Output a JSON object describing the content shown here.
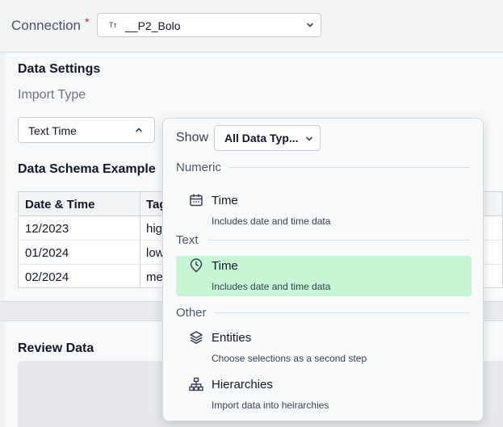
{
  "connection": {
    "label": "Connection",
    "required_marker": "*",
    "type_glyph": "Tт",
    "value": "__P2_Bolo"
  },
  "data_settings": {
    "title": "Data Settings",
    "import_type_label": "Import Type",
    "import_type_value": "Text Time"
  },
  "schema": {
    "title": "Data Schema Example",
    "columns": [
      "Date & Time",
      "Tag"
    ],
    "rows": [
      [
        "12/2023",
        "hig"
      ],
      [
        "01/2024",
        "low"
      ],
      [
        "02/2024",
        "me"
      ]
    ]
  },
  "review": {
    "title": "Review Data"
  },
  "dropdown": {
    "show_label": "Show",
    "filter_value": "All Data Typ...",
    "groups": [
      {
        "label": "Numeric",
        "options": [
          {
            "title": "Time",
            "description": "Includes date and time data",
            "icon": "calendar-icon",
            "selected": false
          }
        ]
      },
      {
        "label": "Text",
        "options": [
          {
            "title": "Time",
            "description": "Includes date and time data",
            "icon": "clock-pin-icon",
            "selected": true
          }
        ]
      },
      {
        "label": "Other",
        "options": [
          {
            "title": "Entities",
            "description": "Choose selections as a second step",
            "icon": "layers-icon",
            "selected": false
          },
          {
            "title": "Hierarchies",
            "description": "Import data into heirarchies",
            "icon": "hierarchy-icon",
            "selected": false
          }
        ]
      }
    ]
  },
  "colors": {
    "selected_bg": "#c6f6d5",
    "required": "#dc2626",
    "page_bg": "#f1f2f4"
  }
}
